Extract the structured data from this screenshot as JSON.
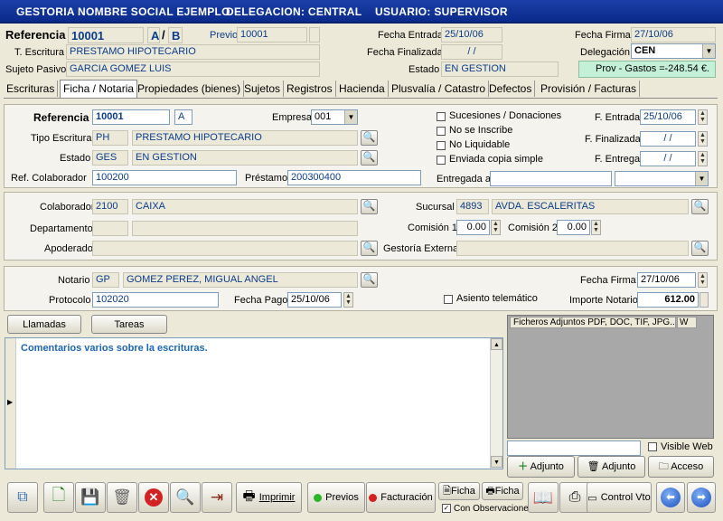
{
  "header": {
    "company": "GESTORIA NOMBRE SOCIAL EJEMPLO",
    "delegation": "DELEGACION:  CENTRAL",
    "user": "USUARIO:  SUPERVISOR"
  },
  "top": {
    "referencia_label": "Referencia",
    "referencia": "10001",
    "suffix_a": "A",
    "slash": "/",
    "suffix_b": "B",
    "previo_label": "Previo",
    "previo": "10001",
    "fecha_entrada_label": "Fecha Entrada",
    "fecha_entrada": "25/10/06",
    "fecha_firma_label": "Fecha Firma",
    "fecha_firma": "27/10/06",
    "t_escritura_label": "T. Escritura",
    "t_escritura": "PRESTAMO HIPOTECARIO",
    "fecha_finalizada_label": "Fecha Finalizada",
    "fecha_finalizada": "/ /",
    "delegacion_label": "Delegación",
    "delegacion": "CEN",
    "sujeto_label": "Sujeto Pasivo",
    "sujeto": "GARCIA GOMEZ LUIS",
    "estado_label": "Estado",
    "estado": "EN GESTION",
    "prov_gastos_label": "Prov - Gastos =",
    "prov_gastos": "-248.54 €."
  },
  "tabs": [
    "Escrituras",
    "Ficha / Notaria",
    "Propiedades (bienes)",
    "Sujetos",
    "Registros",
    "Hacienda",
    "Plusvalía / Catastro",
    "Defectos",
    "Provisión / Facturas"
  ],
  "ficha": {
    "referencia_label": "Referencia",
    "referencia": "10001",
    "ref_suffix": "A",
    "empresa_label": "Empresa",
    "empresa": "001",
    "tipo_label": "Tipo Escritura",
    "tipo_code": "PH",
    "tipo_desc": "PRESTAMO HIPOTECARIO",
    "estado_label": "Estado",
    "estado_code": "GES",
    "estado_desc": "EN GESTION",
    "refcol_label": "Ref. Colaborador",
    "refcol": "100200",
    "prestamo_label": "Préstamo",
    "prestamo": "200300400",
    "chk_sucesiones": "Sucesiones / Donaciones",
    "chk_noinscribe": "No se Inscribe",
    "chk_noliquidable": "No Liquidable",
    "chk_copia": "Enviada copia simple",
    "f_entrada_label": "F. Entrada",
    "f_entrada": "25/10/06",
    "f_finalizada_label": "F. Finalizada",
    "f_finalizada": "/ /",
    "f_entrega_label": "F. Entrega",
    "f_entrega": "/ /",
    "entregada_label": "Entregada a"
  },
  "colab": {
    "colaborador_label": "Colaborador",
    "colaborador_code": "2100",
    "colaborador_name": "CAIXA",
    "departamento_label": "Departamento",
    "apoderado_label": "Apoderado",
    "sucursal_label": "Sucursal",
    "sucursal_code": "4893",
    "sucursal_name": "AVDA. ESCALERITAS",
    "comision1_label": "Comisión 1",
    "comision1": "0.00",
    "comision2_label": "Comisión 2",
    "comision2": "0.00",
    "gestoria_label": "Gestoría Externa"
  },
  "notario": {
    "notario_label": "Notario",
    "notario_code": "GP",
    "notario_name": "GOMEZ PEREZ, MIGUAL ANGEL",
    "fecha_firma_label": "Fecha Firma",
    "fecha_firma": "27/10/06",
    "protocolo_label": "Protocolo",
    "protocolo": "102020",
    "fecha_pago_label": "Fecha Pago",
    "fecha_pago": "25/10/06",
    "asiento_label": "Asiento telemático",
    "importe_label": "Importe Notario",
    "importe": "612.00"
  },
  "comments": {
    "llamadas": "Llamadas",
    "tareas": "Tareas",
    "text": "Comentarios varios sobre la escrituras."
  },
  "files": {
    "header": "Ficheros Adjuntos  PDF, DOC, TIF, JPG...",
    "col_w": "W",
    "visible_web": "Visible Web",
    "adjunto_add": "Adjunto",
    "adjunto_del": "Adjunto",
    "acceso": "Acceso"
  },
  "toolbar": {
    "imprimir": "Imprimir",
    "previos": "Previos",
    "facturacion": "Facturación",
    "ficha1": "Ficha",
    "ficha2": "Ficha",
    "con_obs": "Con Observaciones",
    "control_vto": "Control Vto"
  }
}
